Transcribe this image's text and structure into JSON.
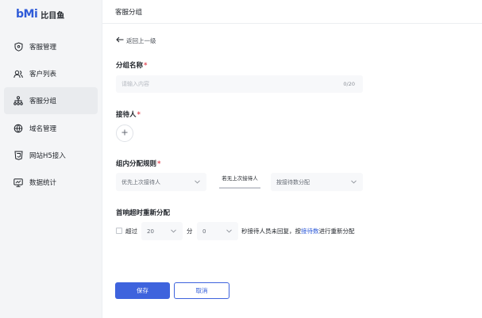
{
  "brand": {
    "mark": "bMi",
    "name": "比目鱼",
    "accent": "#2f5bd8"
  },
  "sidebar": {
    "items": [
      {
        "label": "客服管理",
        "icon": "shield-icon"
      },
      {
        "label": "客户列表",
        "icon": "users-icon"
      },
      {
        "label": "客服分组",
        "icon": "org-tree-icon",
        "active": true
      },
      {
        "label": "域名管理",
        "icon": "globe-icon"
      },
      {
        "label": "网站H5接入",
        "icon": "h5-icon"
      },
      {
        "label": "数据统计",
        "icon": "monitor-chart-icon"
      }
    ]
  },
  "header": {
    "title": "客服分组"
  },
  "back": {
    "label": "返回上一级"
  },
  "form": {
    "group_name": {
      "label": "分组名称",
      "required_mark": "*",
      "placeholder": "请输入内容",
      "counter": "0/20"
    },
    "receptionist": {
      "label": "接待人",
      "required_mark": "*"
    },
    "rule": {
      "label": "组内分配规则",
      "required_mark": "*",
      "primary_select": "优先上次接待人",
      "fallback_label": "若无上次接待人",
      "secondary_select": "按接待数分配"
    },
    "timeout": {
      "label": "首响超时重新分配",
      "checkbox_label": "超过",
      "minutes_value": "20",
      "minutes_unit": "分",
      "seconds_value": "0",
      "suffix_text": "秒接待人员未回复，按",
      "suffix_link": "接待数",
      "suffix_end": "进行重新分配"
    }
  },
  "actions": {
    "save": "保存",
    "cancel": "取消"
  }
}
